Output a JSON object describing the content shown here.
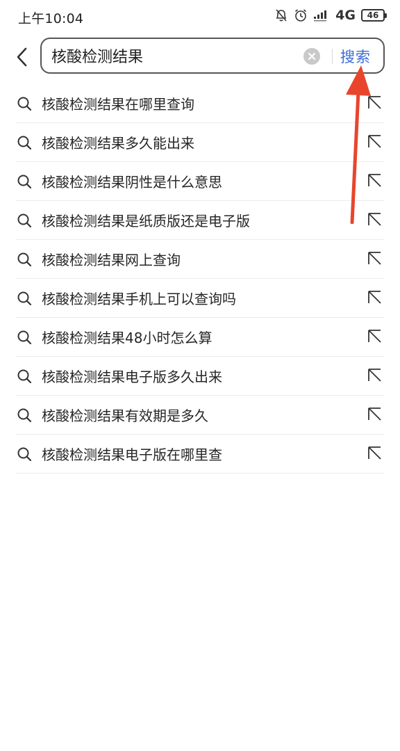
{
  "status_bar": {
    "time": "上午10:04",
    "network": "4G",
    "battery": "46",
    "icons": [
      "mute-icon",
      "alarm-icon",
      "signal-icon",
      "battery-icon"
    ]
  },
  "search": {
    "query": "核酸检测结果",
    "submit_label": "搜索"
  },
  "suggestions": [
    "核酸检测结果在哪里查询",
    "核酸检测结果多久能出来",
    "核酸检测结果阴性是什么意思",
    "核酸检测结果是纸质版还是电子版",
    "核酸检测结果网上查询",
    "核酸检测结果手机上可以查询吗",
    "核酸检测结果48小时怎么算",
    "核酸检测结果电子版多久出来",
    "核酸检测结果有效期是多久",
    "核酸检测结果电子版在哪里查"
  ],
  "colors": {
    "accent": "#3b6bd6",
    "annotation": "#e8452c",
    "divider": "#ececec"
  }
}
